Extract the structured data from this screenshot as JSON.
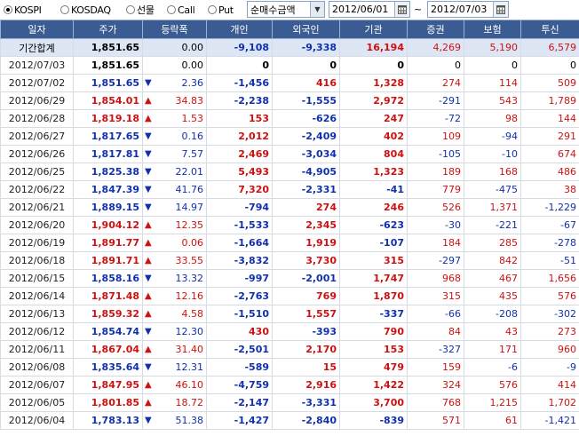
{
  "toolbar": {
    "radios": [
      {
        "label": "KOSPI",
        "selected": true
      },
      {
        "label": "KOSDAQ",
        "selected": false
      },
      {
        "label": "선물",
        "selected": false
      },
      {
        "label": "Call",
        "selected": false
      },
      {
        "label": "Put",
        "selected": false
      }
    ],
    "measure_select": "순매수금액",
    "date_from": "2012/06/01",
    "date_sep": "~",
    "date_to": "2012/07/03"
  },
  "table": {
    "headers": [
      "일자",
      "주가",
      "등락폭",
      "개인",
      "외국인",
      "기관",
      "증권",
      "보험",
      "투신"
    ],
    "rows": [
      {
        "date": "기간합계",
        "price": "1,851.65",
        "dir": "",
        "chg": "0.00",
        "ind": "-9,108",
        "for": "-9,338",
        "inst": "16,194",
        "sec": "4,269",
        "ins": "5,190",
        "inv": "6,579"
      },
      {
        "date": "2012/07/03",
        "price": "1,851.65",
        "dir": "",
        "chg": "0.00",
        "ind": "0",
        "for": "0",
        "inst": "0",
        "sec": "0",
        "ins": "0",
        "inv": "0"
      },
      {
        "date": "2012/07/02",
        "price": "1,851.65",
        "dir": "down",
        "chg": "2.36",
        "ind": "-1,456",
        "for": "416",
        "inst": "1,328",
        "sec": "274",
        "ins": "114",
        "inv": "509"
      },
      {
        "date": "2012/06/29",
        "price": "1,854.01",
        "dir": "up",
        "chg": "34.83",
        "ind": "-2,238",
        "for": "-1,555",
        "inst": "2,972",
        "sec": "-291",
        "ins": "543",
        "inv": "1,789"
      },
      {
        "date": "2012/06/28",
        "price": "1,819.18",
        "dir": "up",
        "chg": "1.53",
        "ind": "153",
        "for": "-626",
        "inst": "247",
        "sec": "-72",
        "ins": "98",
        "inv": "144"
      },
      {
        "date": "2012/06/27",
        "price": "1,817.65",
        "dir": "down",
        "chg": "0.16",
        "ind": "2,012",
        "for": "-2,409",
        "inst": "402",
        "sec": "109",
        "ins": "-94",
        "inv": "291"
      },
      {
        "date": "2012/06/26",
        "price": "1,817.81",
        "dir": "down",
        "chg": "7.57",
        "ind": "2,469",
        "for": "-3,034",
        "inst": "804",
        "sec": "-105",
        "ins": "-10",
        "inv": "674"
      },
      {
        "date": "2012/06/25",
        "price": "1,825.38",
        "dir": "down",
        "chg": "22.01",
        "ind": "5,493",
        "for": "-4,905",
        "inst": "1,323",
        "sec": "189",
        "ins": "168",
        "inv": "486"
      },
      {
        "date": "2012/06/22",
        "price": "1,847.39",
        "dir": "down",
        "chg": "41.76",
        "ind": "7,320",
        "for": "-2,331",
        "inst": "-41",
        "sec": "779",
        "ins": "-475",
        "inv": "38"
      },
      {
        "date": "2012/06/21",
        "price": "1,889.15",
        "dir": "down",
        "chg": "14.97",
        "ind": "-794",
        "for": "274",
        "inst": "246",
        "sec": "526",
        "ins": "1,371",
        "inv": "-1,229"
      },
      {
        "date": "2012/06/20",
        "price": "1,904.12",
        "dir": "up",
        "chg": "12.35",
        "ind": "-1,533",
        "for": "2,345",
        "inst": "-623",
        "sec": "-30",
        "ins": "-221",
        "inv": "-67"
      },
      {
        "date": "2012/06/19",
        "price": "1,891.77",
        "dir": "up",
        "chg": "0.06",
        "ind": "-1,664",
        "for": "1,919",
        "inst": "-107",
        "sec": "184",
        "ins": "285",
        "inv": "-278"
      },
      {
        "date": "2012/06/18",
        "price": "1,891.71",
        "dir": "up",
        "chg": "33.55",
        "ind": "-3,832",
        "for": "3,730",
        "inst": "315",
        "sec": "-297",
        "ins": "842",
        "inv": "-51"
      },
      {
        "date": "2012/06/15",
        "price": "1,858.16",
        "dir": "down",
        "chg": "13.32",
        "ind": "-997",
        "for": "-2,001",
        "inst": "1,747",
        "sec": "968",
        "ins": "467",
        "inv": "1,656"
      },
      {
        "date": "2012/06/14",
        "price": "1,871.48",
        "dir": "up",
        "chg": "12.16",
        "ind": "-2,763",
        "for": "769",
        "inst": "1,870",
        "sec": "315",
        "ins": "435",
        "inv": "576"
      },
      {
        "date": "2012/06/13",
        "price": "1,859.32",
        "dir": "up",
        "chg": "4.58",
        "ind": "-1,510",
        "for": "1,557",
        "inst": "-337",
        "sec": "-66",
        "ins": "-208",
        "inv": "-302"
      },
      {
        "date": "2012/06/12",
        "price": "1,854.74",
        "dir": "down",
        "chg": "12.30",
        "ind": "430",
        "for": "-393",
        "inst": "790",
        "sec": "84",
        "ins": "43",
        "inv": "273"
      },
      {
        "date": "2012/06/11",
        "price": "1,867.04",
        "dir": "up",
        "chg": "31.40",
        "ind": "-2,501",
        "for": "2,170",
        "inst": "153",
        "sec": "-327",
        "ins": "171",
        "inv": "960"
      },
      {
        "date": "2012/06/08",
        "price": "1,835.64",
        "dir": "down",
        "chg": "12.31",
        "ind": "-589",
        "for": "15",
        "inst": "479",
        "sec": "159",
        "ins": "-6",
        "inv": "-9"
      },
      {
        "date": "2012/06/07",
        "price": "1,847.95",
        "dir": "up",
        "chg": "46.10",
        "ind": "-4,759",
        "for": "2,916",
        "inst": "1,422",
        "sec": "324",
        "ins": "576",
        "inv": "414"
      },
      {
        "date": "2012/06/05",
        "price": "1,801.85",
        "dir": "up",
        "chg": "18.72",
        "ind": "-2,147",
        "for": "-3,331",
        "inst": "3,700",
        "sec": "768",
        "ins": "1,215",
        "inv": "1,702"
      },
      {
        "date": "2012/06/04",
        "price": "1,783.13",
        "dir": "down",
        "chg": "51.38",
        "ind": "-1,427",
        "for": "-2,840",
        "inst": "-839",
        "sec": "571",
        "ins": "61",
        "inv": "-1,421"
      }
    ]
  },
  "colors": {
    "up": "#d01010",
    "down": "#1030b0",
    "header_bg": "#3b5c92",
    "sum_row_bg": "#dde6f4"
  },
  "icons": {
    "up": "triangle-up-icon",
    "down": "triangle-down-icon",
    "calendar": "calendar-icon",
    "dropdown": "chevron-down-icon"
  }
}
